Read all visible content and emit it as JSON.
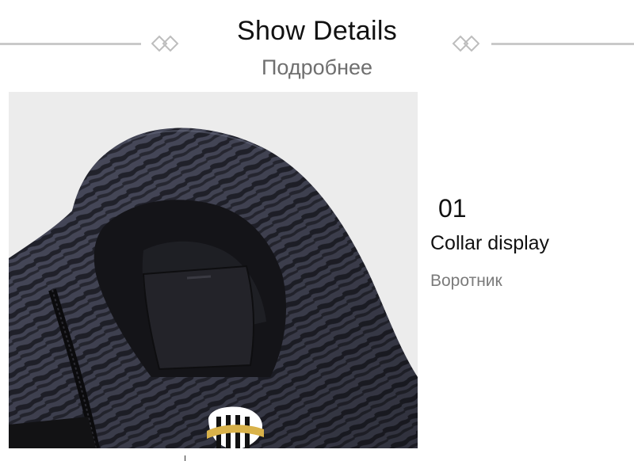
{
  "header": {
    "title": "Show Details",
    "subtitle": "Подробнее",
    "divider_icon": "double-diamond-icon",
    "line_color": "#c9c9c9"
  },
  "photo": {
    "subject": "hooded jacket collar",
    "badge_text": "JUVENTUS"
  },
  "info": {
    "number": "01",
    "heading": "Collar display",
    "subheading": "Воротник"
  }
}
